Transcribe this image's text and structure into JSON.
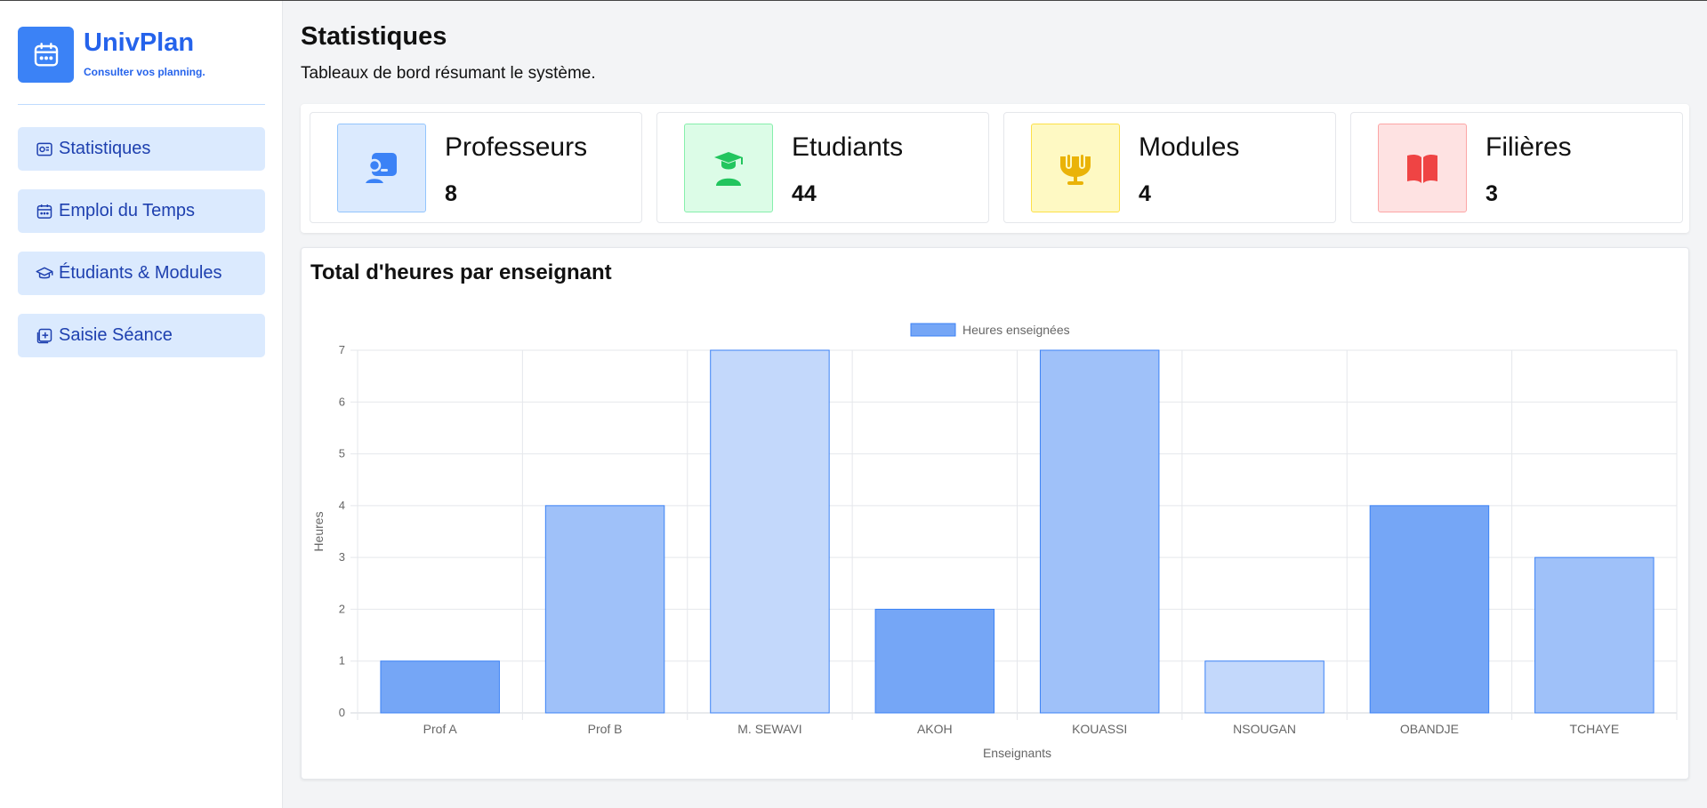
{
  "brand": {
    "name": "UnivPlan",
    "tagline": "Consulter vos planning."
  },
  "sidebar": {
    "items": [
      {
        "label": "Statistiques",
        "icon": "stats-icon"
      },
      {
        "label": "Emploi du Temps",
        "icon": "calendar-icon"
      },
      {
        "label": "Étudiants & Modules",
        "icon": "graduation-cap-icon"
      },
      {
        "label": "Saisie Séance",
        "icon": "add-square-icon"
      }
    ]
  },
  "page": {
    "title": "Statistiques",
    "subtitle": "Tableaux de bord résumant le système."
  },
  "cards": [
    {
      "label": "Professeurs",
      "value": "8",
      "icon": "teacher-icon",
      "color": "#3b82f6",
      "bg": "#dbeafe",
      "border": "#93c5fd"
    },
    {
      "label": "Etudiants",
      "value": "44",
      "icon": "student-icon",
      "color": "#22c55e",
      "bg": "#dcfce7",
      "border": "#86efac"
    },
    {
      "label": "Modules",
      "value": "4",
      "icon": "module-icon",
      "color": "#eab308",
      "bg": "#fef9c3",
      "border": "#fde047"
    },
    {
      "label": "Filières",
      "value": "3",
      "icon": "book-icon",
      "color": "#ef4444",
      "bg": "#fee2e2",
      "border": "#fca5a5"
    }
  ],
  "chart_panel": {
    "title": "Total d'heures par enseignant"
  },
  "chart_data": {
    "type": "bar",
    "categories": [
      "Prof A",
      "Prof B",
      "M. SEWAVI",
      "AKOH",
      "KOUASSI",
      "NSOUGAN",
      "OBANDJE",
      "TCHAYE"
    ],
    "series": [
      {
        "name": "Heures enseignées",
        "values": [
          1,
          4,
          7,
          2,
          7,
          1,
          4,
          3
        ]
      }
    ],
    "bar_colors": [
      "#75a6f6",
      "#9fc1f9",
      "#c3d8fb",
      "#75a6f6",
      "#9fc1f9",
      "#c3d8fb",
      "#75a6f6",
      "#9fc1f9"
    ],
    "border_color": "#3b82f6",
    "xlabel": "Enseignants",
    "ylabel": "Heures",
    "ylim": [
      0,
      7
    ],
    "yticks": [
      0,
      1,
      2,
      3,
      4,
      5,
      6,
      7
    ],
    "grid": true,
    "legend": "top"
  }
}
